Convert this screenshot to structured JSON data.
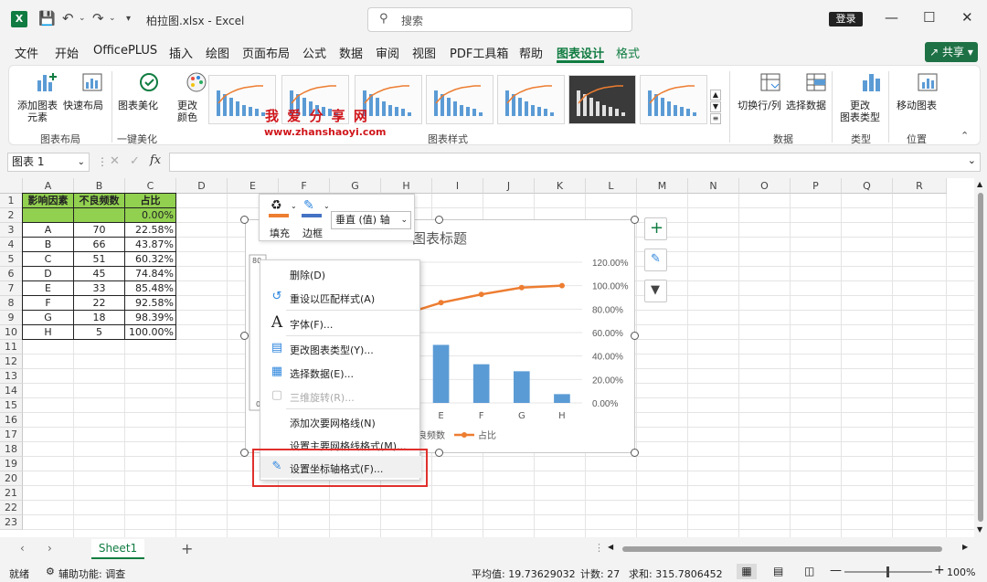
{
  "titlebar": {
    "search_placeholder": "搜索",
    "title": "柏拉图.xlsx - Excel",
    "login": "登录"
  },
  "menu": {
    "items": [
      "文件",
      "开始",
      "OfficePLUS",
      "插入",
      "绘图",
      "页面布局",
      "公式",
      "数据",
      "审阅",
      "视图",
      "PDF工具箱",
      "帮助",
      "图表设计",
      "格式"
    ],
    "share": "共享"
  },
  "ribbon": {
    "add_element": "添加图表\n元素",
    "quick_layout": "快速布局",
    "beautify": "图表美化",
    "change_color": "更改\n颜色",
    "switch_rowcol": "切换行/列",
    "select_data": "选择数据",
    "change_type": "更改\n图表类型",
    "move_chart": "移动图表",
    "group_layout": "图表布局",
    "group_beautify": "一键美化",
    "group_styles": "图表样式",
    "group_data": "数据",
    "group_type": "类型",
    "group_location": "位置",
    "watermark_cn": "我 爱 分 享 网",
    "watermark_url": "www.zhanshaoyi.com"
  },
  "formula": {
    "namebox": "图表 1",
    "fx": "fx"
  },
  "columns": [
    "A",
    "B",
    "C",
    "D",
    "E",
    "F",
    "G",
    "H",
    "I",
    "J",
    "K",
    "L",
    "M",
    "N",
    "O",
    "P",
    "Q",
    "R"
  ],
  "rows": [
    "1",
    "2",
    "3",
    "4",
    "5",
    "6",
    "7",
    "8",
    "9",
    "10",
    "11",
    "12",
    "13",
    "14",
    "15",
    "16",
    "17",
    "18",
    "19",
    "20",
    "21",
    "22",
    "23"
  ],
  "table": {
    "headers": [
      "影响因素",
      "不良频数",
      "占比"
    ],
    "row2": [
      "",
      "",
      "0.00%"
    ],
    "data": [
      [
        "A",
        "70",
        "22.58%"
      ],
      [
        "B",
        "66",
        "43.87%"
      ],
      [
        "C",
        "51",
        "60.32%"
      ],
      [
        "D",
        "45",
        "74.84%"
      ],
      [
        "E",
        "33",
        "85.48%"
      ],
      [
        "F",
        "22",
        "92.58%"
      ],
      [
        "G",
        "18",
        "98.39%"
      ],
      [
        "H",
        "5",
        "100.00%"
      ]
    ]
  },
  "chart": {
    "title": "图表标题",
    "legend_bar": "良频数",
    "legend_line": "占比",
    "left_axis_visible": [
      "80",
      "0"
    ],
    "right_axis": [
      "120.00%",
      "100.00%",
      "80.00%",
      "60.00%",
      "40.00%",
      "20.00%",
      "0.00%"
    ],
    "visible_categories": [
      "E",
      "F",
      "G",
      "H"
    ],
    "bar_color": "#5b9bd5",
    "line_color": "#ed7d31"
  },
  "chart_data": {
    "type": "bar",
    "title": "图表标题",
    "categories": [
      "A",
      "B",
      "C",
      "D",
      "E",
      "F",
      "G",
      "H"
    ],
    "series": [
      {
        "name": "不良频数",
        "values": [
          70,
          66,
          51,
          45,
          33,
          22,
          18,
          5
        ]
      },
      {
        "name": "占比",
        "values": [
          22.58,
          43.87,
          60.32,
          74.84,
          85.48,
          92.58,
          98.39,
          100.0
        ]
      }
    ],
    "ylim": [
      0,
      80
    ],
    "y2lim": [
      0,
      120
    ]
  },
  "mini_toolbar": {
    "fill": "填充",
    "border": "边框",
    "select": "垂直 (值) 轴"
  },
  "context_menu": {
    "items": [
      "删除(D)",
      "重设以匹配样式(A)",
      "字体(F)...",
      "更改图表类型(Y)...",
      "选择数据(E)...",
      "三维旋转(R)...",
      "添加次要网格线(N)",
      "设置主要网格线格式(M)...",
      "设置坐标轴格式(F)..."
    ]
  },
  "sheet_tab": "Sheet1",
  "status": {
    "ready": "就绪",
    "accessibility": "辅助功能: 调查",
    "average": "平均值: 19.73629032",
    "count": "计数: 27",
    "sum": "求和: 315.7806452",
    "zoom": "100%"
  },
  "colors": {
    "excel_green": "#107c41",
    "header_green": "#92d050",
    "highlight_red": "#e0302c"
  }
}
